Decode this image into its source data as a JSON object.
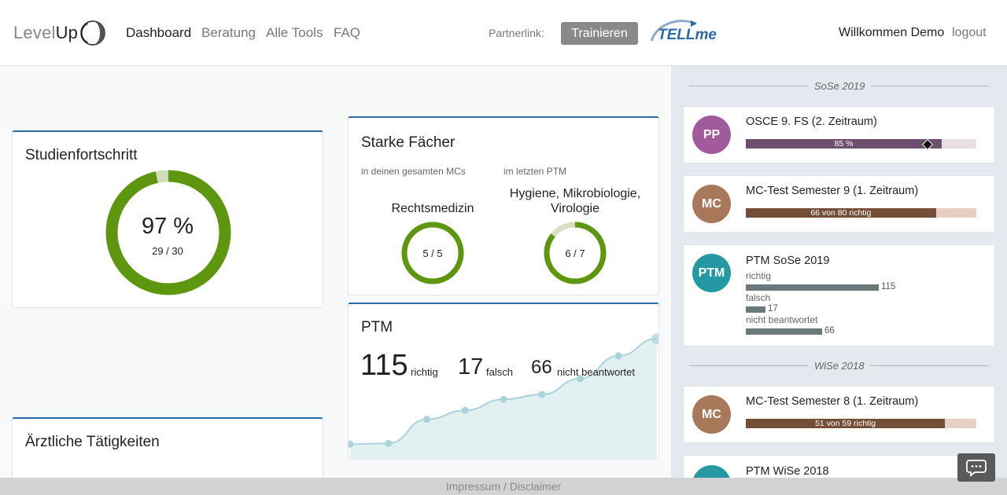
{
  "nav": {
    "logo_light": "Level",
    "logo_dark": "Up",
    "links": [
      "Dashboard",
      "Beratung",
      "Alle Tools",
      "FAQ"
    ],
    "partner_label": "Partnerlink:",
    "train_button": "Trainieren",
    "tellme_logo": "TELLme",
    "welcome": "Willkommen Demo",
    "logout": "logout"
  },
  "progress": {
    "title": "Studienfortschritt",
    "percent_label": "97 %",
    "count_label": "29 / 30",
    "done": 29,
    "total": 30
  },
  "strong": {
    "title": "Starke Fächer",
    "left": {
      "caption": "in deinen gesamten MCs",
      "subject_lines": [
        "Rechtsmedizin"
      ],
      "score_label": "5 / 5",
      "correct": 5,
      "total": 5
    },
    "right": {
      "caption": "im letzten PTM",
      "subject_lines": [
        "Hygiene, Mikrobiologie,",
        "Virologie"
      ],
      "score_label": "6 / 7",
      "correct": 6,
      "total": 7
    }
  },
  "ptm": {
    "title": "PTM",
    "correct": "115",
    "correct_label": "richtig",
    "wrong": "17",
    "wrong_label": "falsch",
    "unanswered": "66",
    "unanswered_label": "nicht beantwortet",
    "trend": [
      118,
      119,
      154,
      167,
      183,
      190,
      213,
      246,
      271
    ]
  },
  "aerztlich": {
    "title": "Ärztliche Tätigkeiten"
  },
  "sidebar": {
    "semesters": [
      "SoSe 2019",
      "WiSe 2018"
    ],
    "cards": [
      {
        "avatar": "PP",
        "title": "OSCE 9. FS (2. Zeitraum)",
        "bar_label": "85 %",
        "value": 85,
        "max": 100,
        "marker": 0.79,
        "color": "#a25b9a",
        "fill": "#6f4f6e",
        "track": "#e6e0e6"
      },
      {
        "avatar": "MC",
        "title": "MC-Test Semester 9 (1. Zeitraum)",
        "bar_label": "66 von 80 richtig",
        "value": 66,
        "max": 80,
        "color": "#a9785a",
        "fill": "#754e37",
        "track": "#e8cfc4"
      },
      {
        "avatar": "PTM",
        "title": "PTM SoSe 2019",
        "rows": [
          {
            "label": "richtig",
            "value": "115"
          },
          {
            "label": "falsch",
            "value": "17"
          },
          {
            "label": "nicht beantwortet",
            "value": "66"
          }
        ],
        "color": "#2499a4"
      },
      {
        "avatar": "MC",
        "title": "MC-Test Semester 8 (1. Zeitraum)",
        "bar_label": "51 von 59 richtig",
        "value": 51,
        "max": 59,
        "color": "#a9785a",
        "fill": "#754e37",
        "track": "#e8cfc4"
      },
      {
        "avatar": "",
        "title": "PTM WiSe 2018",
        "color": "#2499a4"
      }
    ]
  },
  "footer": "Impressum / Disclaimer"
}
